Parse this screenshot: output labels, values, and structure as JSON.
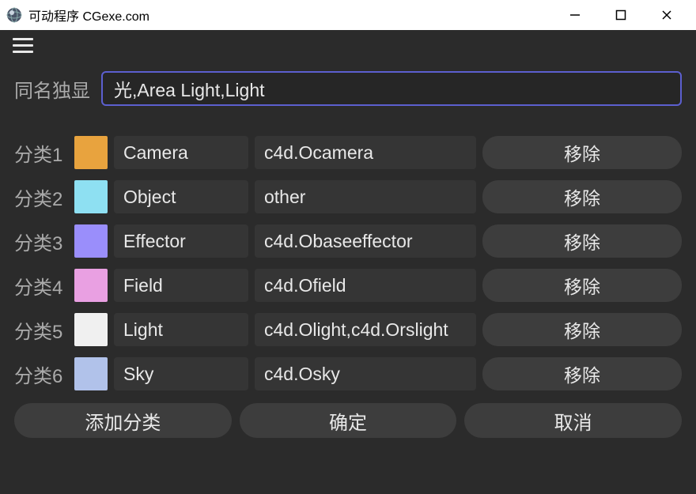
{
  "window": {
    "title": "可动程序 CGexe.com"
  },
  "labels": {
    "nameDisplay": "同名独显"
  },
  "nameValue": "光,Area Light,Light",
  "categories": [
    {
      "label": "分类1",
      "color": "#e8a33e",
      "name": "Camera",
      "type": "c4d.Ocamera",
      "remove": "移除"
    },
    {
      "label": "分类2",
      "color": "#8ee0f2",
      "name": "Object",
      "type": "other",
      "remove": "移除"
    },
    {
      "label": "分类3",
      "color": "#9a8efb",
      "name": "Effector",
      "type": "c4d.Obaseeffector",
      "remove": "移除"
    },
    {
      "label": "分类4",
      "color": "#e9a0e2",
      "name": "Field",
      "type": "c4d.Ofield",
      "remove": "移除"
    },
    {
      "label": "分类5",
      "color": "#f0f0f0",
      "name": "Light",
      "type": "c4d.Olight,c4d.Orslight",
      "remove": "移除"
    },
    {
      "label": "分类6",
      "color": "#b1c2ea",
      "name": "Sky",
      "type": "c4d.Osky",
      "remove": "移除"
    }
  ],
  "buttons": {
    "addCategory": "添加分类",
    "ok": "确定",
    "cancel": "取消"
  }
}
